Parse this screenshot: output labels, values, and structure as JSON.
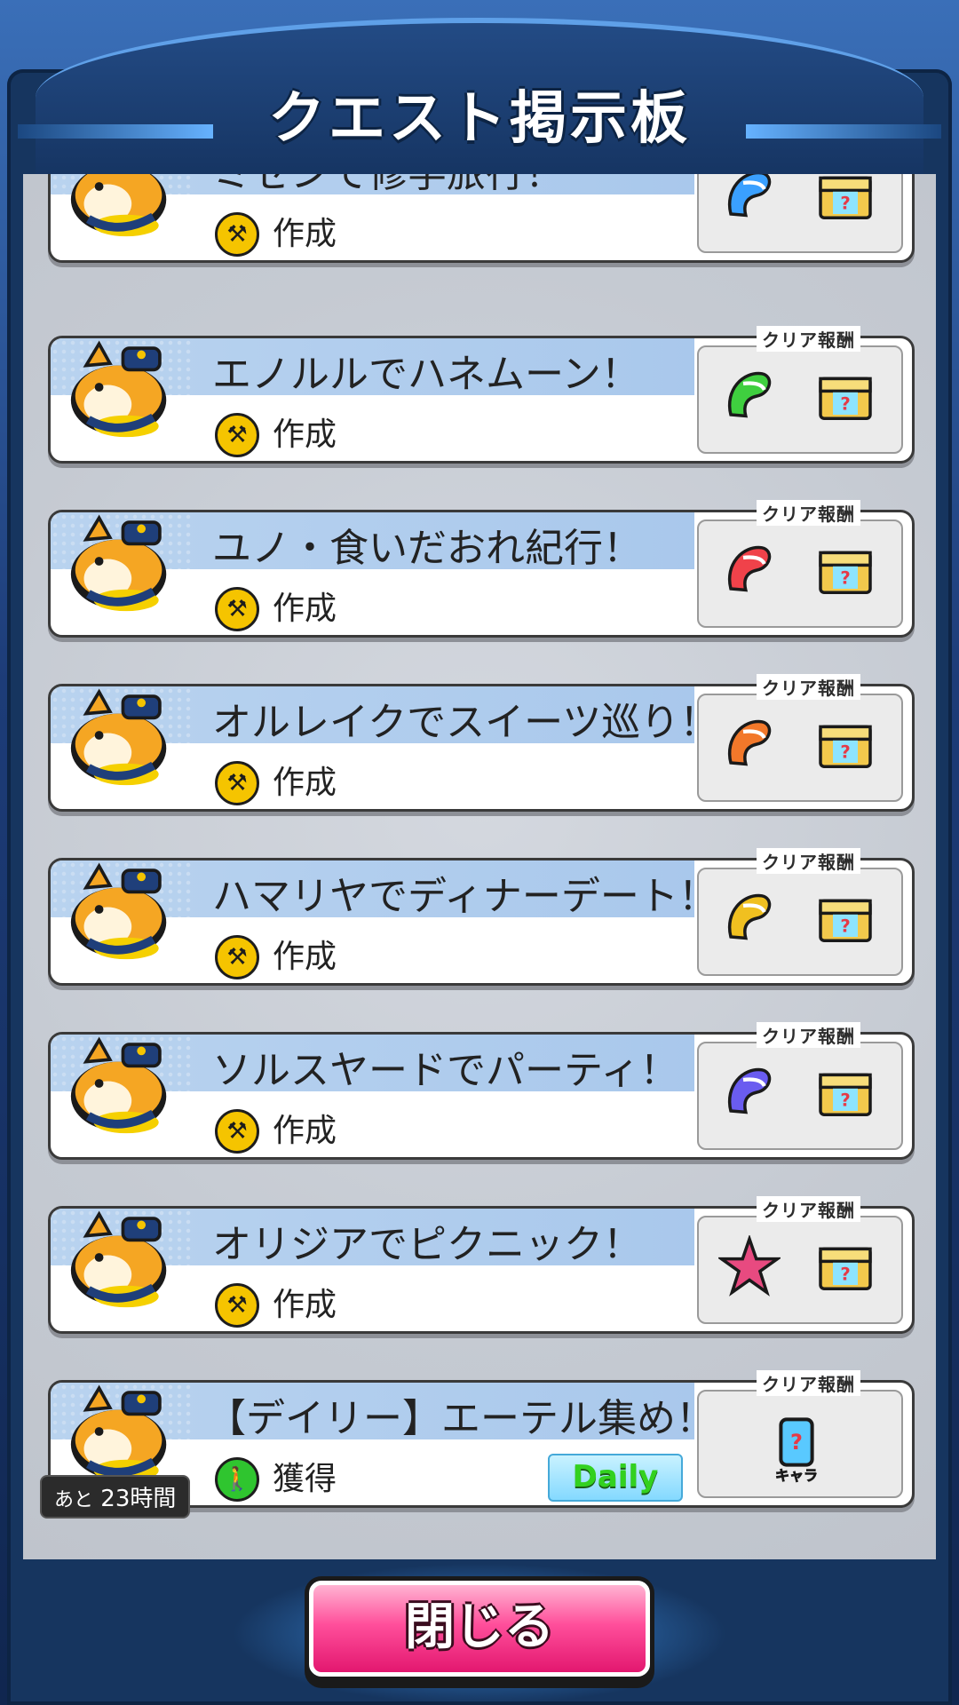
{
  "header": {
    "title": "クエスト掲示板"
  },
  "reward_label": "クリア報酬",
  "quests": [
    {
      "title": "ミゼンで修学旅行！",
      "type": "作成",
      "type_icon": "anvil-icon",
      "reward_a": "green-feather-icon",
      "reward_a_color": "#3aa0ff",
      "reward_b": "treasure-box-icon",
      "top_cut": true
    },
    {
      "title": "エノルルでハネムーン！",
      "type": "作成",
      "type_icon": "anvil-icon",
      "reward_a": "feather-icon",
      "reward_a_color": "#3fcf3f",
      "reward_b": "treasure-box-icon"
    },
    {
      "title": "ユノ・食いだおれ紀行！",
      "type": "作成",
      "type_icon": "anvil-icon",
      "reward_a": "feather-icon",
      "reward_a_color": "#f0424a",
      "reward_b": "treasure-box-icon"
    },
    {
      "title": "オルレイクでスイーツ巡り！",
      "type": "作成",
      "type_icon": "anvil-icon",
      "reward_a": "feather-icon",
      "reward_a_color": "#f2782a",
      "reward_b": "treasure-box-icon"
    },
    {
      "title": "ハマリヤでディナーデート！",
      "type": "作成",
      "type_icon": "anvil-icon",
      "reward_a": "feather-icon",
      "reward_a_color": "#f0c020",
      "reward_b": "treasure-box-icon"
    },
    {
      "title": "ソルスヤードでパーティ！",
      "type": "作成",
      "type_icon": "anvil-icon",
      "reward_a": "feather-icon",
      "reward_a_color": "#6a5cf0",
      "reward_b": "treasure-box-icon"
    },
    {
      "title": "オリジアでピクニック！",
      "type": "作成",
      "type_icon": "anvil-icon",
      "reward_a": "star-icon",
      "reward_a_color": "#e84a80",
      "reward_b": "treasure-box-icon"
    },
    {
      "title": "【デイリー】エーテル集め！",
      "type": "獲得",
      "type_icon": "person-icon",
      "reward_a": "chara-spray-icon",
      "reward_a_color": "#59c9ff",
      "badge": "Daily",
      "timer_prefix": "あと",
      "timer_value": "23時間"
    }
  ],
  "reward_char_label": "キャラ",
  "close_button": {
    "label": "閉じる"
  }
}
